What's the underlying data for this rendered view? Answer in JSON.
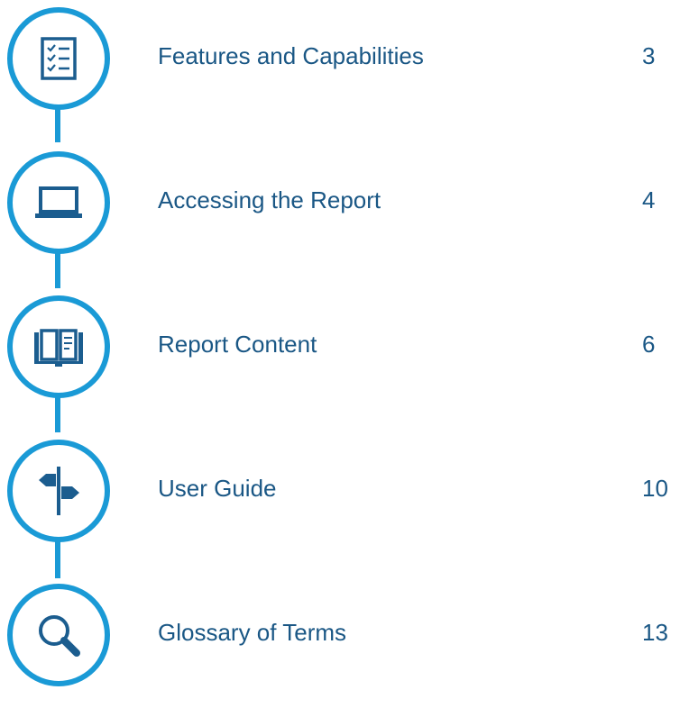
{
  "colors": {
    "accent": "#1a9ad6",
    "icon": "#1b5d8f",
    "text": "#1a5785"
  },
  "toc": {
    "items": [
      {
        "icon": "checklist-icon",
        "label": "Features and Capabilities",
        "page": "3"
      },
      {
        "icon": "laptop-icon",
        "label": "Accessing the Report",
        "page": "4"
      },
      {
        "icon": "book-icon",
        "label": "Report Content",
        "page": "6"
      },
      {
        "icon": "signpost-icon",
        "label": "User Guide",
        "page": "10"
      },
      {
        "icon": "magnifier-icon",
        "label": "Glossary of Terms",
        "page": "13"
      }
    ]
  }
}
